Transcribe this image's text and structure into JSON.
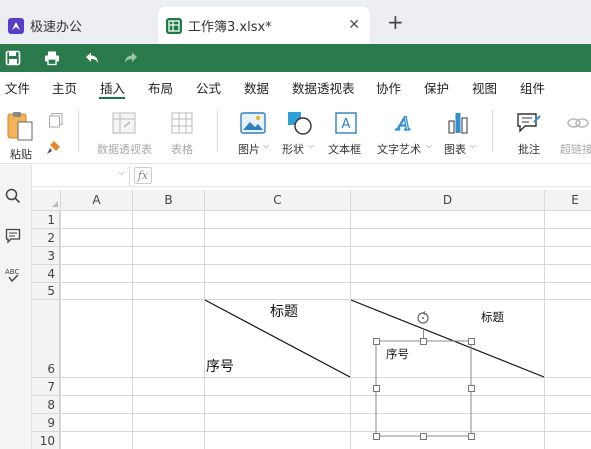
{
  "tabs": {
    "home": {
      "label": "极速办公",
      "icon": "app-logo-icon"
    },
    "file": {
      "label": "工作簿3.xlsx*",
      "icon": "spreadsheet-icon",
      "close": "✕"
    },
    "new_tab": "+"
  },
  "quick_toolbar": {
    "items": [
      "save-icon",
      "print-icon",
      "undo-icon",
      "redo-icon"
    ]
  },
  "menu": {
    "items": [
      "文件",
      "主页",
      "插入",
      "布局",
      "公式",
      "数据",
      "数据透视表",
      "协作",
      "保护",
      "视图",
      "组件"
    ],
    "active": "插入"
  },
  "ribbon": {
    "paste": "粘贴",
    "pivot_table": "数据透视表",
    "table": "表格",
    "picture": "图片",
    "shape": "形状",
    "text_box": "文本框",
    "word_art": "文字艺术",
    "chart": "图表",
    "comment": "批注",
    "hyperlink": "超链接"
  },
  "formula_bar": {
    "name_box": "",
    "fx": "fx",
    "formula": ""
  },
  "side_panel": {
    "items": [
      "search-icon",
      "comment-icon",
      "spellcheck-icon"
    ],
    "spellcheck_label": "ABC"
  },
  "sheet": {
    "columns": [
      "A",
      "B",
      "C",
      "D",
      "E"
    ],
    "rows": [
      "1",
      "2",
      "3",
      "4",
      "5",
      "6",
      "7",
      "8",
      "9",
      "10"
    ],
    "cells": {
      "C6_title": "标题",
      "C6_seq": "序号"
    },
    "shape": {
      "title": "标题",
      "seq": "序号"
    }
  },
  "colors": {
    "brand_green": "#2a7a4b",
    "accent_green": "#1a7a44",
    "grid_line": "#d8d8d8"
  }
}
